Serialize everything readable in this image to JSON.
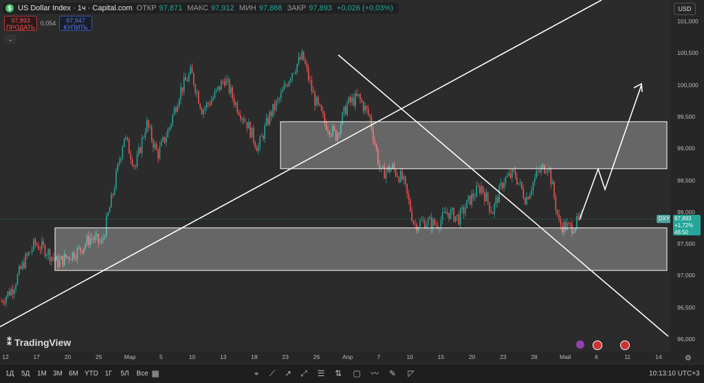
{
  "header": {
    "symbol": "US Dollar Index · 1ч · Capital.com",
    "open_label": "ОТКР",
    "open_value": "97,871",
    "high_label": "МАКС",
    "high_value": "97,912",
    "low_label": "МИН",
    "low_value": "97,868",
    "close_label": "ЗАКР",
    "close_value": "97,893",
    "change": "+0,026 (+0,03%)"
  },
  "trade": {
    "sell_price": "97,893",
    "sell_label": "ПРОДАТЬ",
    "spread": "0,054",
    "buy_price": "97,947",
    "buy_label": "КУПИТЬ"
  },
  "currency": "USD",
  "last_price": {
    "ticker": "DXY",
    "price": "97,893",
    "change": "+1,72%",
    "timer": "46:50"
  },
  "brand": "TradingView",
  "toolbar": {
    "ranges": [
      "1Д",
      "5Д",
      "1М",
      "3М",
      "6М",
      "YTD",
      "1Г",
      "5Л",
      "Все"
    ],
    "time": "10:13:10 UTC+3"
  },
  "chart_data": {
    "type": "candlestick",
    "y_ticks": [
      "101,000",
      "100,500",
      "100,000",
      "99,500",
      "99,000",
      "98,500",
      "98,000",
      "97,500",
      "97,000",
      "96,500",
      "96,000"
    ],
    "y_range": [
      96.0,
      101.0
    ],
    "x_ticks": [
      "12",
      "17",
      "20",
      "25",
      "Мар",
      "5",
      "10",
      "13",
      "18",
      "23",
      "26",
      "Апр",
      "7",
      "10",
      "15",
      "20",
      "23",
      "28",
      "Май",
      "6",
      "11",
      "14"
    ],
    "series_approx": [
      [
        0,
        96.6
      ],
      [
        1,
        96.8
      ],
      [
        2,
        97.2
      ],
      [
        3,
        97.5
      ],
      [
        4,
        97.4
      ],
      [
        5,
        97.2
      ],
      [
        6,
        97.3
      ],
      [
        7,
        97.4
      ],
      [
        8,
        97.6
      ],
      [
        9,
        97.5
      ],
      [
        10,
        98.3
      ],
      [
        11,
        99.2
      ],
      [
        12,
        98.7
      ],
      [
        13,
        99.4
      ],
      [
        14,
        98.9
      ],
      [
        15,
        99.3
      ],
      [
        16,
        99.9
      ],
      [
        17,
        100.2
      ],
      [
        18,
        99.6
      ],
      [
        19,
        99.8
      ],
      [
        20,
        100.1
      ],
      [
        21,
        99.7
      ],
      [
        22,
        99.4
      ],
      [
        23,
        99.0
      ],
      [
        24,
        99.5
      ],
      [
        25,
        99.8
      ],
      [
        26,
        100.2
      ],
      [
        27,
        100.45
      ],
      [
        28,
        99.8
      ],
      [
        29,
        99.4
      ],
      [
        30,
        99.2
      ],
      [
        31,
        99.7
      ],
      [
        32,
        99.8
      ],
      [
        33,
        99.5
      ],
      [
        34,
        98.6
      ],
      [
        35,
        98.7
      ],
      [
        36,
        98.5
      ],
      [
        37,
        97.8
      ],
      [
        38,
        97.85
      ],
      [
        39,
        97.8
      ],
      [
        40,
        98.0
      ],
      [
        41,
        97.9
      ],
      [
        42,
        98.2
      ],
      [
        43,
        98.4
      ],
      [
        44,
        98.0
      ],
      [
        45,
        98.5
      ],
      [
        46,
        98.6
      ],
      [
        47,
        98.2
      ],
      [
        48,
        98.6
      ],
      [
        49,
        98.75
      ],
      [
        50,
        97.8
      ],
      [
        51,
        97.75
      ],
      [
        52,
        97.89
      ]
    ],
    "zones": [
      {
        "y_low": 98.68,
        "y_high": 99.42
      },
      {
        "y_low": 97.08,
        "y_high": 97.75
      }
    ]
  }
}
